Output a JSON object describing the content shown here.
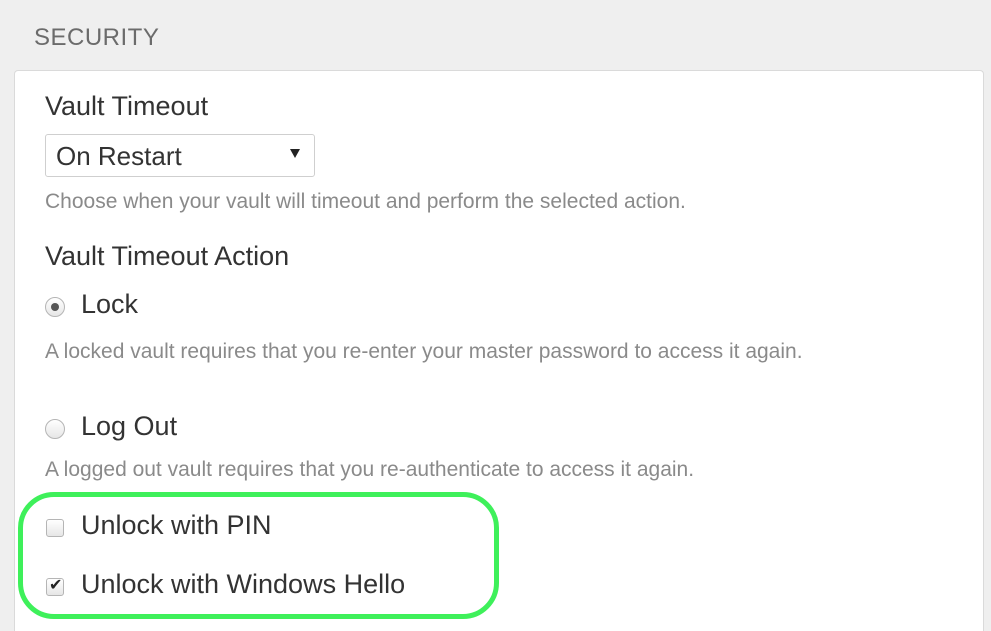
{
  "section": {
    "title": "SECURITY"
  },
  "vault_timeout": {
    "label": "Vault Timeout",
    "selected": "On Restart",
    "help": "Choose when your vault will timeout and perform the selected action."
  },
  "vault_timeout_action": {
    "label": "Vault Timeout Action",
    "options": [
      {
        "label": "Lock",
        "checked": true,
        "help": "A locked vault requires that you re-enter your master password to access it again."
      },
      {
        "label": "Log Out",
        "checked": false,
        "help": "A logged out vault requires that you re-authenticate to access it again."
      }
    ]
  },
  "unlock_options": [
    {
      "label": "Unlock with PIN",
      "checked": false
    },
    {
      "label": "Unlock with Windows Hello",
      "checked": true
    }
  ],
  "colors": {
    "highlight": "#3ef05a",
    "page_background": "#efefef",
    "panel_background": "#ffffff",
    "help_text": "#8a8a8a"
  },
  "icons": {
    "dropdown": "caret-down-icon",
    "check": "checkmark-icon"
  }
}
